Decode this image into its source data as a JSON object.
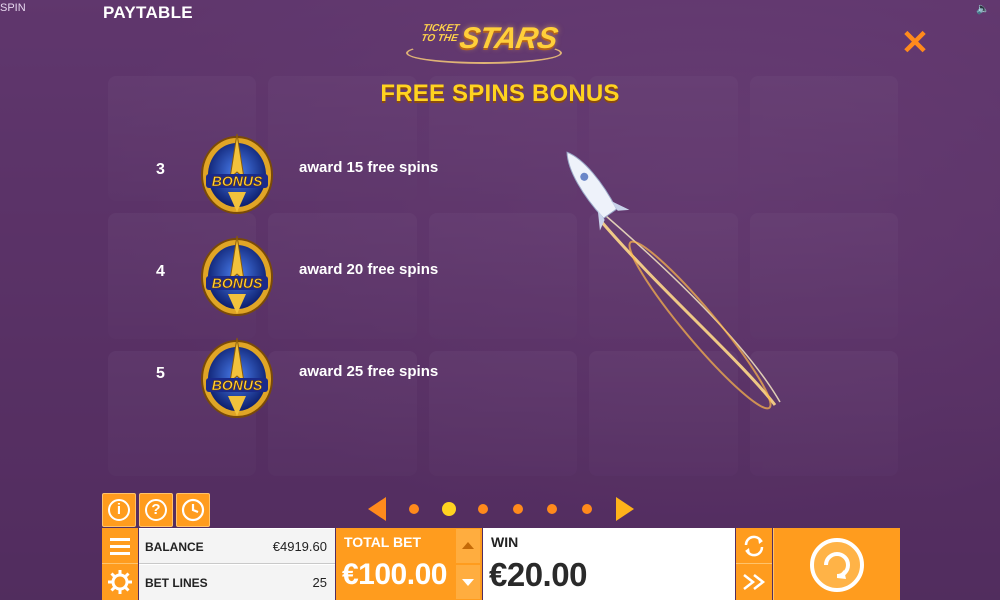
{
  "top_bar": {
    "spin_tag": "SPIN",
    "title": "PAYTABLE"
  },
  "logo": {
    "line1": "TICKET",
    "line2": "TO THE",
    "word": "STARS"
  },
  "close_icon": "close-icon",
  "section_title": "FREE SPINS BONUS",
  "payouts": [
    {
      "count": "3",
      "symbol": "BONUS",
      "description": "award 15 free spins"
    },
    {
      "count": "4",
      "symbol": "BONUS",
      "description": "award 20 free spins"
    },
    {
      "count": "5",
      "symbol": "BONUS",
      "description": "award 25 free spins"
    }
  ],
  "pagination": {
    "total_pages": 6,
    "current_page": 2
  },
  "bottom_bar": {
    "balance_label": "BALANCE",
    "balance_value": "€4919.60",
    "betlines_label": "BET LINES",
    "betlines_value": "25",
    "totalbet_label": "TOTAL BET",
    "totalbet_value": "€100.00",
    "win_label": "WIN",
    "win_value": "€20.00"
  },
  "colors": {
    "accent_orange": "#ff9c1e",
    "title_yellow": "#ffd320",
    "background_purple": "#5a3566"
  }
}
